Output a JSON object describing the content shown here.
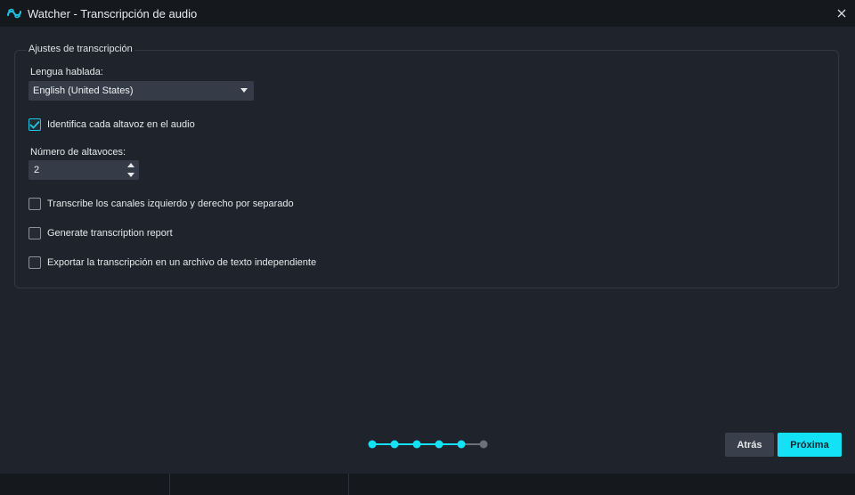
{
  "window": {
    "title": "Watcher - Transcripción de audio",
    "icon": "watcher-logo-icon",
    "close_icon": "close-icon"
  },
  "settings": {
    "group_title": "Ajustes de transcripción",
    "language_label": "Lengua hablada:",
    "language_value": "English (United States)",
    "identify_speakers_label": "Identifica cada altavoz en el audio",
    "identify_speakers_checked": true,
    "speaker_count_label": "Número de altavoces:",
    "speaker_count_value": "2",
    "separate_channels_label": "Transcribe los canales izquierdo y derecho por separado",
    "separate_channels_checked": false,
    "report_label": "Generate transcription report",
    "report_checked": false,
    "export_text_label": "Exportar la transcripción en un archivo de texto independiente",
    "export_text_checked": false
  },
  "wizard": {
    "total_steps": 6,
    "completed_steps": 5,
    "back_label": "Atrás",
    "next_label": "Próxima"
  },
  "colors": {
    "accent": "#13e1f5",
    "background": "#1f242c",
    "titlebar": "#15181d",
    "inactive_step": "#6b717a"
  }
}
